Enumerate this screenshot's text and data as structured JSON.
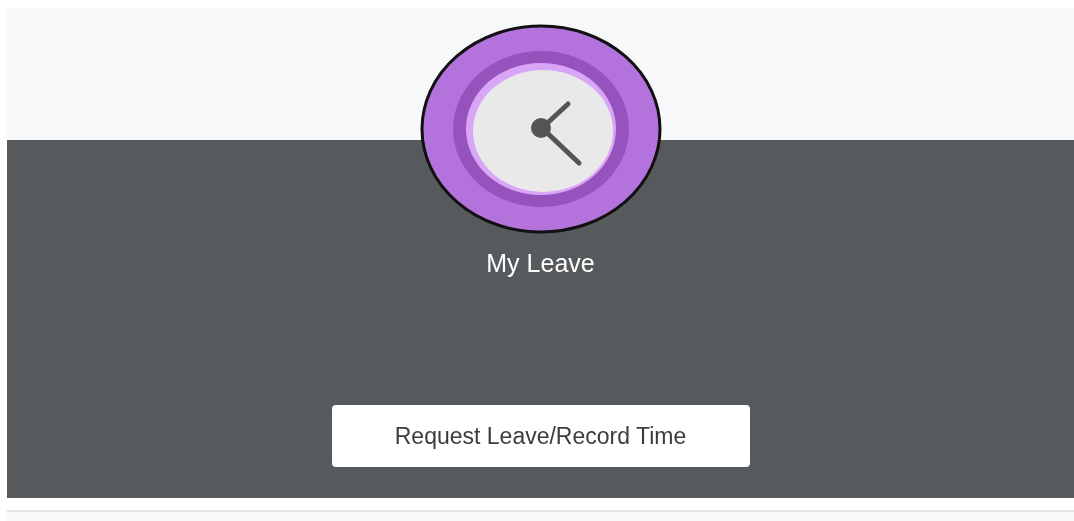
{
  "tile": {
    "title": "My Leave",
    "button": "Request Leave/Record Time"
  }
}
